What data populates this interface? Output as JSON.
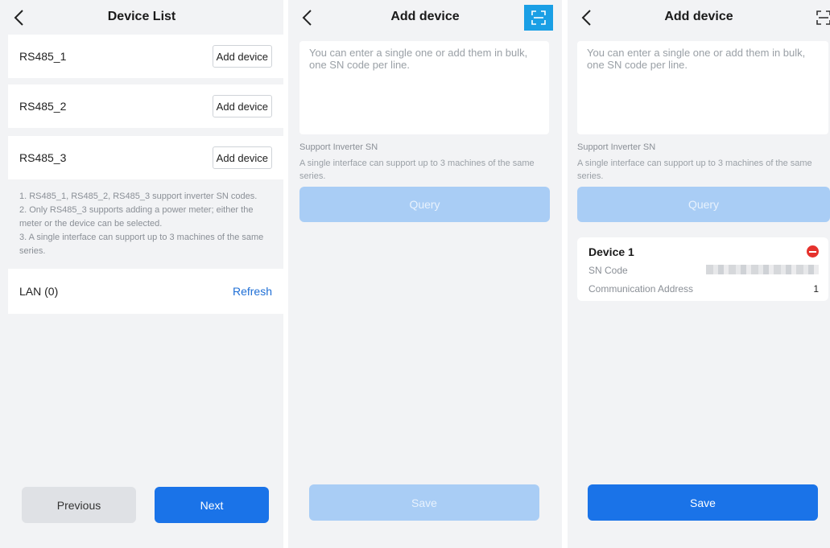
{
  "screen1": {
    "title": "Device List",
    "ports": [
      {
        "name": "RS485_1",
        "button": "Add device"
      },
      {
        "name": "RS485_2",
        "button": "Add device"
      },
      {
        "name": "RS485_3",
        "button": "Add device"
      }
    ],
    "notes": [
      "1. RS485_1, RS485_2, RS485_3 support inverter SN codes.",
      "2. Only RS485_3 supports adding a power meter; either the meter or the device can be selected.",
      "3. A single interface can support up to 3 machines of the same series."
    ],
    "lan_label": "LAN (0)",
    "refresh_label": "Refresh",
    "previous_label": "Previous",
    "next_label": "Next"
  },
  "screen2": {
    "title": "Add device",
    "sn_placeholder": "You can enter a single one or add them in bulk, one SN code per line.",
    "support_title": "Support Inverter SN",
    "support_desc": "A single interface can support up to 3 machines of the same series.",
    "query_label": "Query",
    "save_label": "Save",
    "scan_highlighted": true
  },
  "screen3": {
    "title": "Add device",
    "sn_placeholder": "You can enter a single one or add them in bulk, one SN code per line.",
    "support_title": "Support Inverter SN",
    "support_desc": "A single interface can support up to 3 machines of the same series.",
    "query_label": "Query",
    "device": {
      "title": "Device 1",
      "sn_label": "SN Code",
      "addr_label": "Communication Address",
      "addr_value": "1"
    },
    "save_label": "Save"
  },
  "colors": {
    "primary": "#1a73e8",
    "primary_disabled": "#a9cdf5",
    "scan_highlight": "#1a9fe5",
    "link": "#1f6fd6",
    "remove": "#e5322d",
    "background": "#f2f3f5"
  },
  "icons": [
    "back-icon",
    "scan-icon",
    "remove-device-icon"
  ]
}
